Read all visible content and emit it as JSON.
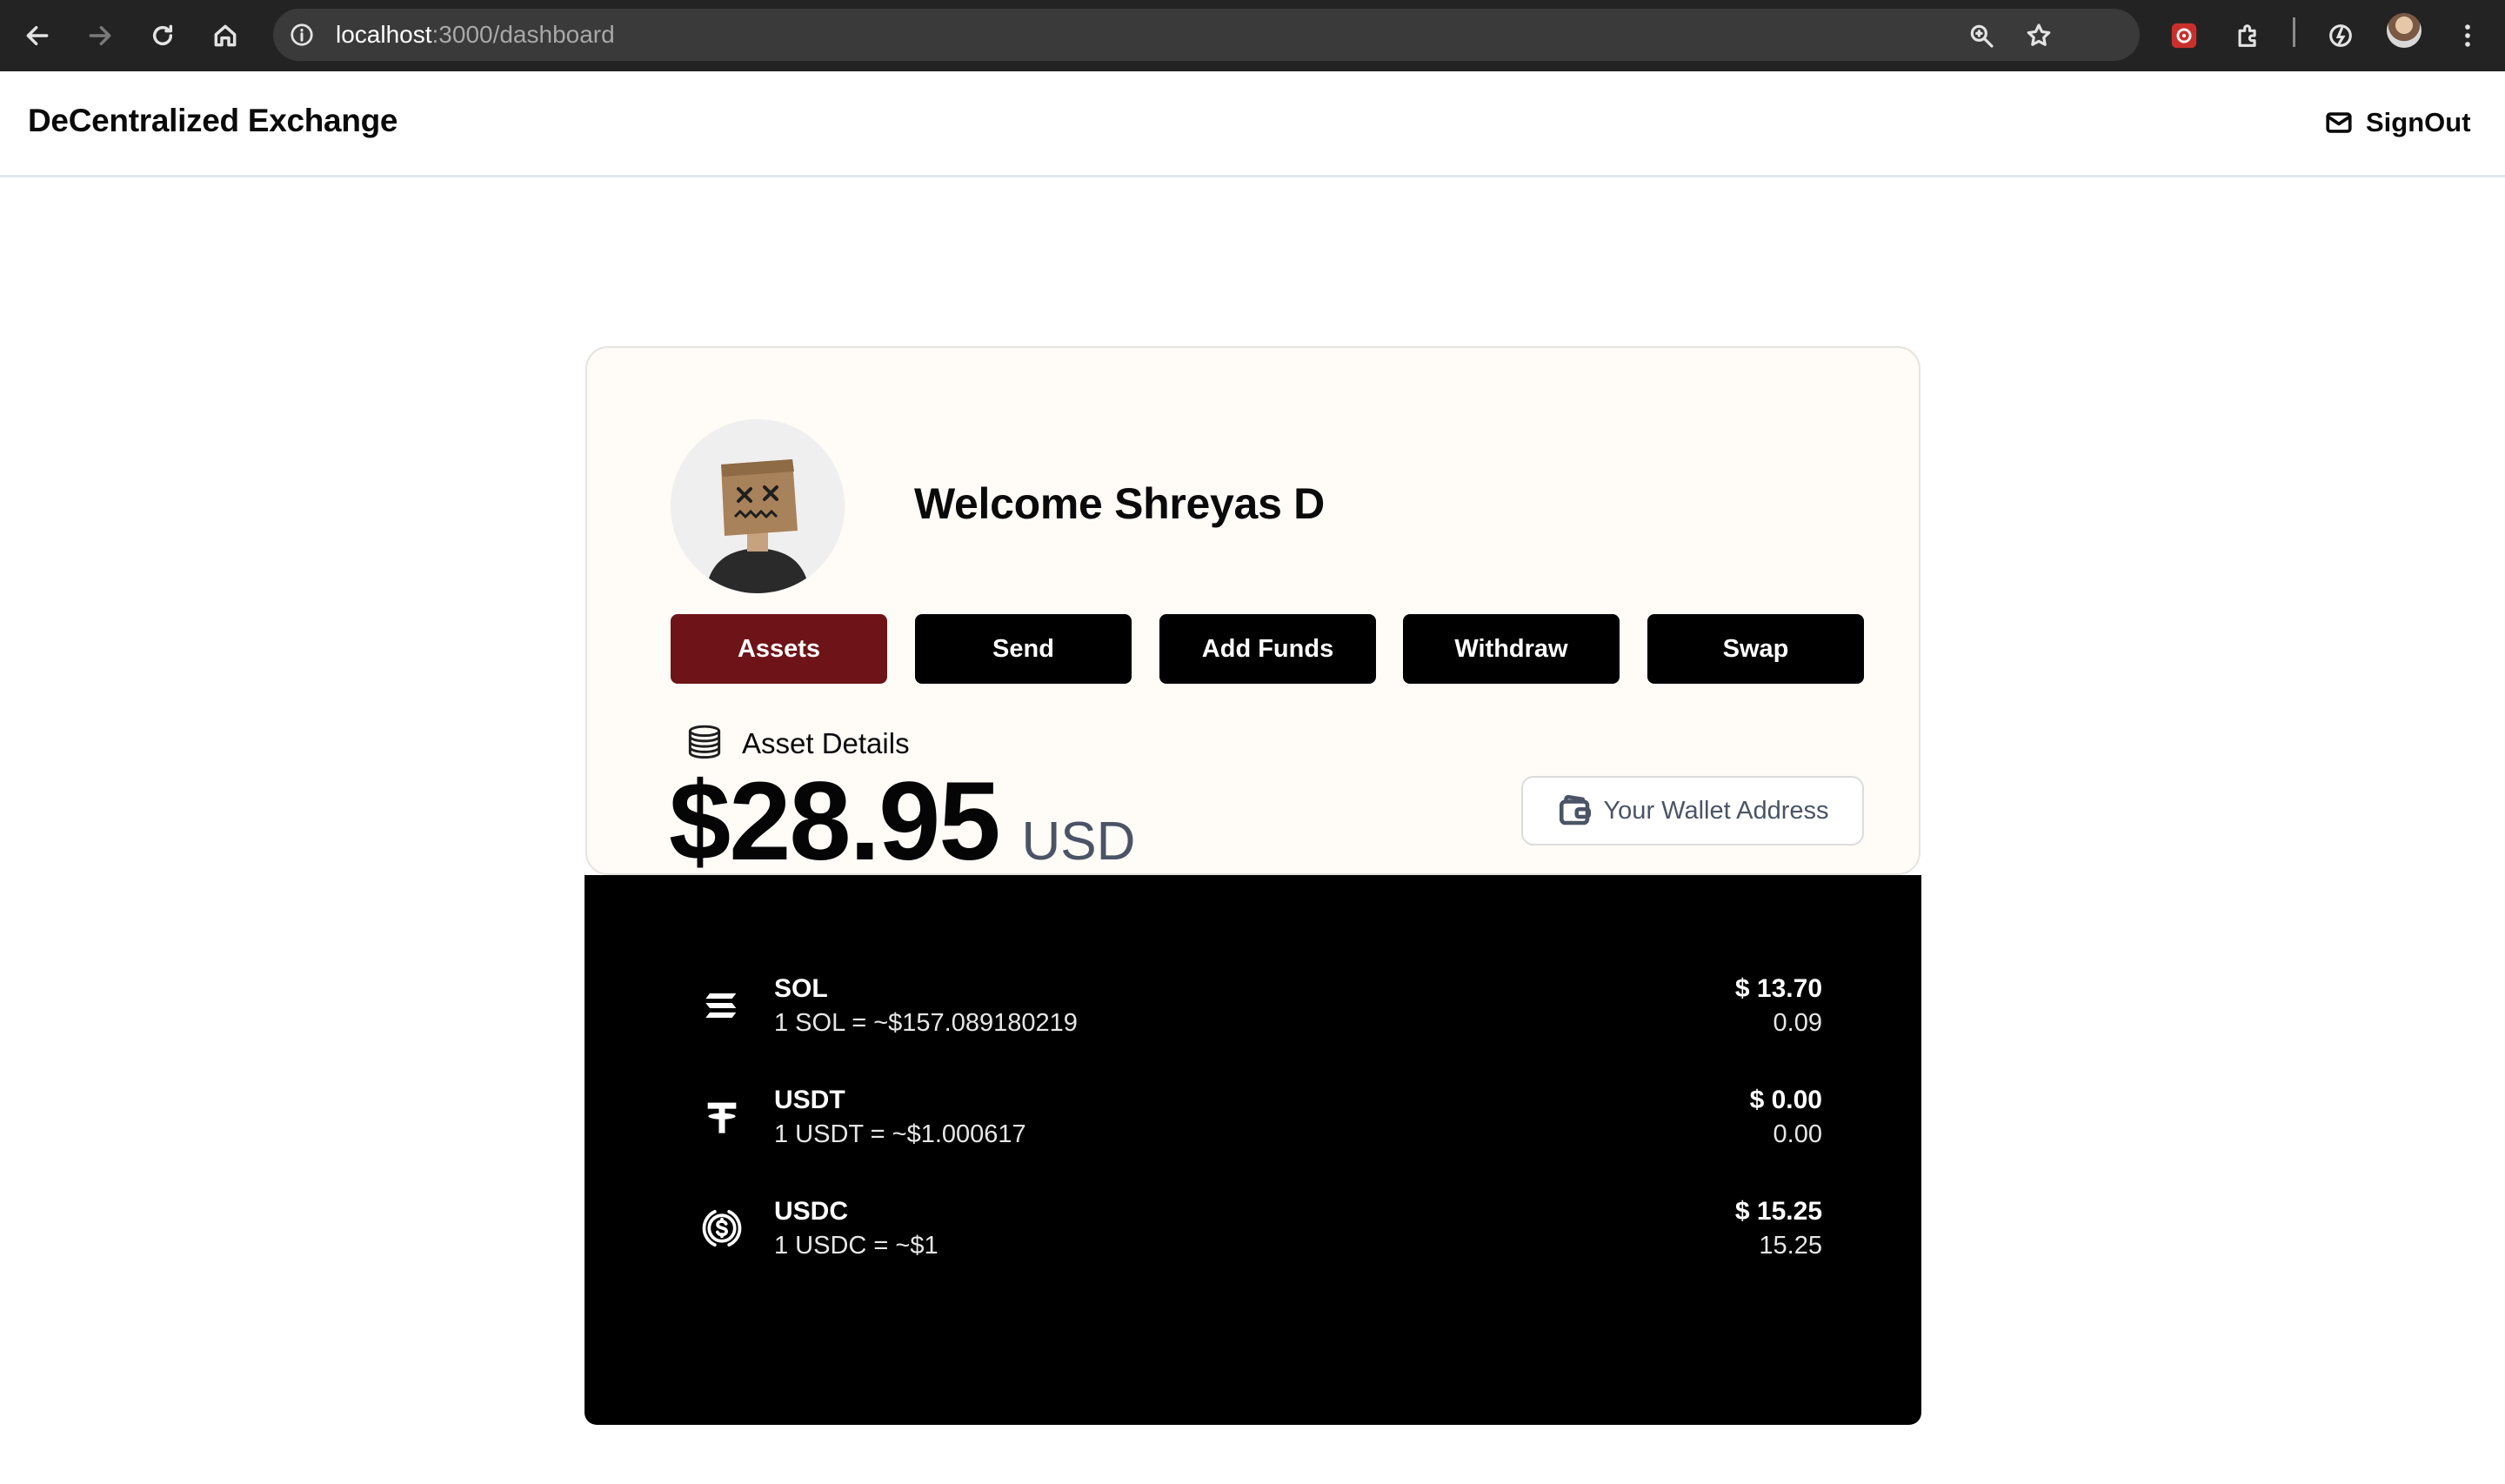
{
  "browser": {
    "url_host": "localhost",
    "url_path": ":3000/dashboard"
  },
  "header": {
    "brand": "DeCentralized Exchange",
    "signout_label": "SignOut"
  },
  "profile": {
    "welcome_text": "Welcome Shreyas D"
  },
  "tabs": [
    {
      "label": "Assets",
      "active": true
    },
    {
      "label": "Send",
      "active": false
    },
    {
      "label": "Add Funds",
      "active": false
    },
    {
      "label": "Withdraw",
      "active": false
    },
    {
      "label": "Swap",
      "active": false
    }
  ],
  "assets": {
    "heading": "Asset Details",
    "total_amount": "$28.95",
    "currency": "USD",
    "wallet_button_label": "Your Wallet Address"
  },
  "tokens": [
    {
      "symbol": "SOL",
      "rate": "1 SOL = ~$157.089180219",
      "usd_value": "$ 13.70",
      "balance": "0.09",
      "icon": "solana-icon"
    },
    {
      "symbol": "USDT",
      "rate": "1 USDT = ~$1.000617",
      "usd_value": "$ 0.00",
      "balance": "0.00",
      "icon": "tether-icon"
    },
    {
      "symbol": "USDC",
      "rate": "1 USDC = ~$1",
      "usd_value": "$ 15.25",
      "balance": "15.25",
      "icon": "usdc-icon"
    }
  ],
  "colors": {
    "active_tab": "#6e1418",
    "card_background": "#fffbf7",
    "token_panel": "#000000"
  }
}
